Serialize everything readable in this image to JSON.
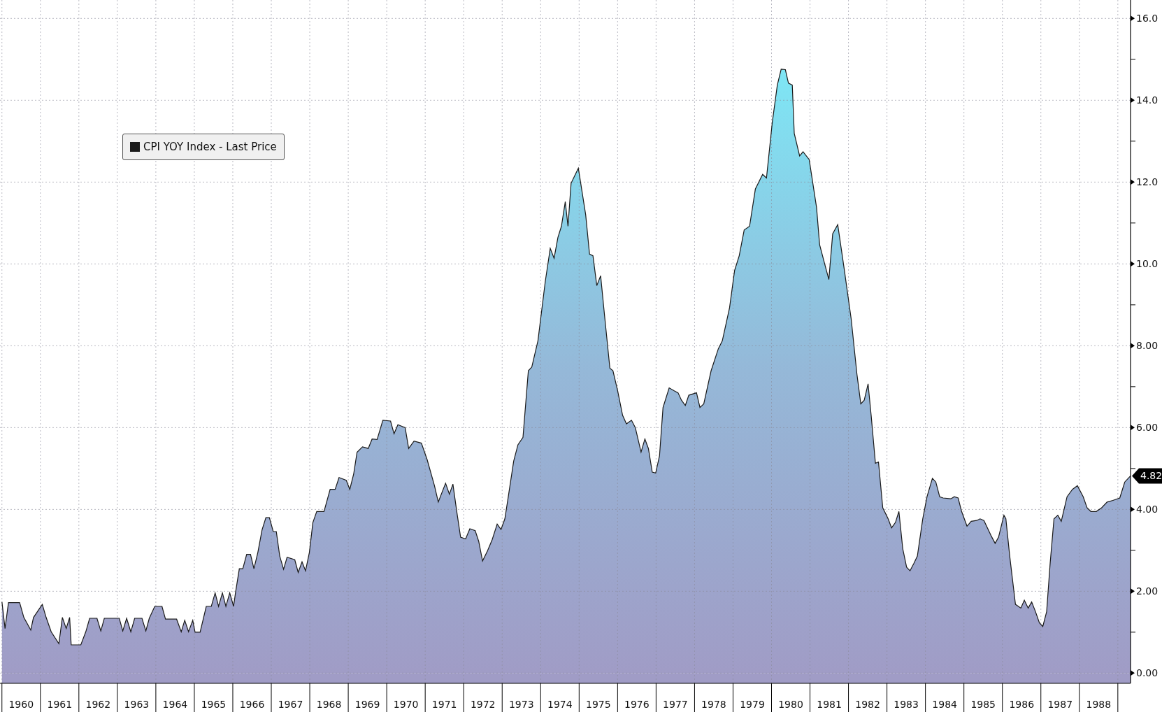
{
  "chart": {
    "last_price": "4.82",
    "chart_data": {
      "type": "area",
      "grid": true,
      "bands": [
        {
          "axis": "y",
          "from": -0.25,
          "to": 0,
          "color": "#a09cc6"
        }
      ],
      "xlim": [
        1959.95,
        1989.33
      ],
      "ylim": [
        -0.25,
        16.45
      ],
      "x": [
        1960.0,
        1960.08,
        1960.17,
        1960.46,
        1960.57,
        1960.75,
        1960.82,
        1961.05,
        1961.15,
        1961.28,
        1961.48,
        1961.57,
        1961.67,
        1961.76,
        1961.8,
        1962.05,
        1962.18,
        1962.28,
        1962.47,
        1962.57,
        1962.66,
        1963.05,
        1963.14,
        1963.24,
        1963.35,
        1963.45,
        1963.64,
        1963.74,
        1963.83,
        1963.97,
        1964.16,
        1964.25,
        1964.54,
        1964.66,
        1964.75,
        1964.85,
        1964.96,
        1965.02,
        1965.15,
        1965.31,
        1965.44,
        1965.54,
        1965.63,
        1965.73,
        1965.82,
        1965.92,
        1966.02,
        1966.07,
        1966.17,
        1966.26,
        1966.36,
        1966.46,
        1966.55,
        1966.65,
        1966.76,
        1966.86,
        1966.95,
        1967.05,
        1967.13,
        1967.22,
        1967.32,
        1967.41,
        1967.61,
        1967.7,
        1967.8,
        1967.89,
        1967.99,
        1968.08,
        1968.18,
        1968.37,
        1968.53,
        1968.66,
        1968.76,
        1968.95,
        1969.04,
        1969.14,
        1969.23,
        1969.37,
        1969.52,
        1969.62,
        1969.75,
        1969.9,
        1970.1,
        1970.19,
        1970.29,
        1970.48,
        1970.57,
        1970.71,
        1970.9,
        1971.05,
        1971.24,
        1971.34,
        1971.53,
        1971.63,
        1971.72,
        1971.82,
        1971.92,
        1972.05,
        1972.16,
        1972.3,
        1972.39,
        1972.49,
        1972.62,
        1972.74,
        1972.87,
        1972.97,
        1973.07,
        1973.16,
        1973.3,
        1973.41,
        1973.54,
        1973.68,
        1973.77,
        1973.93,
        1974.12,
        1974.25,
        1974.35,
        1974.45,
        1974.54,
        1974.64,
        1974.71,
        1974.79,
        1974.98,
        1975.17,
        1975.27,
        1975.36,
        1975.46,
        1975.56,
        1975.65,
        1975.8,
        1975.88,
        1976.0,
        1976.13,
        1976.23,
        1976.36,
        1976.46,
        1976.61,
        1976.71,
        1976.8,
        1976.9,
        1976.99,
        1977.09,
        1977.18,
        1977.34,
        1977.47,
        1977.57,
        1977.66,
        1977.76,
        1977.85,
        1978.05,
        1978.14,
        1978.24,
        1978.43,
        1978.62,
        1978.72,
        1978.91,
        1979.04,
        1979.16,
        1979.29,
        1979.43,
        1979.58,
        1979.77,
        1979.87,
        1980.02,
        1980.15,
        1980.25,
        1980.36,
        1980.44,
        1980.54,
        1980.59,
        1980.73,
        1980.82,
        1980.98,
        1981.17,
        1981.25,
        1981.4,
        1981.49,
        1981.59,
        1981.72,
        1981.88,
        1982.07,
        1982.22,
        1982.32,
        1982.41,
        1982.51,
        1982.59,
        1982.7,
        1982.78,
        1982.89,
        1983.03,
        1983.12,
        1983.22,
        1983.31,
        1983.41,
        1983.51,
        1983.6,
        1983.7,
        1983.79,
        1983.93,
        1984.04,
        1984.18,
        1984.27,
        1984.37,
        1984.46,
        1984.66,
        1984.75,
        1984.85,
        1984.94,
        1985.08,
        1985.19,
        1985.33,
        1985.42,
        1985.52,
        1985.71,
        1985.81,
        1985.9,
        1986.04,
        1986.09,
        1986.19,
        1986.34,
        1986.48,
        1986.57,
        1986.67,
        1986.76,
        1986.86,
        1986.96,
        1987.05,
        1987.15,
        1987.24,
        1987.34,
        1987.44,
        1987.53,
        1987.68,
        1987.82,
        1987.95,
        1988.1,
        1988.2,
        1988.3,
        1988.44,
        1988.58,
        1988.72,
        1988.87,
        1989.05,
        1989.18,
        1989.33
      ],
      "series": [
        {
          "name": "CPI YOY Index - Last Price",
          "color": "#1a1a1a",
          "values": [
            1.74,
            1.09,
            1.72,
            1.72,
            1.36,
            1.05,
            1.36,
            1.68,
            1.36,
            1.01,
            0.72,
            1.36,
            1.09,
            1.36,
            0.69,
            0.69,
            1.01,
            1.34,
            1.34,
            1.03,
            1.34,
            1.34,
            1.03,
            1.34,
            1.01,
            1.34,
            1.34,
            1.03,
            1.34,
            1.63,
            1.63,
            1.32,
            1.32,
            1.01,
            1.29,
            1.01,
            1.29,
            1.0,
            1.0,
            1.63,
            1.63,
            1.96,
            1.63,
            1.96,
            1.63,
            1.96,
            1.63,
            1.96,
            2.55,
            2.55,
            2.9,
            2.9,
            2.55,
            2.95,
            3.5,
            3.8,
            3.8,
            3.46,
            3.46,
            2.86,
            2.54,
            2.83,
            2.77,
            2.46,
            2.72,
            2.5,
            2.95,
            3.68,
            3.95,
            3.95,
            4.49,
            4.49,
            4.78,
            4.71,
            4.49,
            4.86,
            5.4,
            5.53,
            5.49,
            5.72,
            5.71,
            6.18,
            6.16,
            5.85,
            6.07,
            6.0,
            5.49,
            5.67,
            5.62,
            5.22,
            4.58,
            4.18,
            4.64,
            4.37,
            4.62,
            3.95,
            3.32,
            3.28,
            3.53,
            3.48,
            3.22,
            2.74,
            2.99,
            3.26,
            3.64,
            3.51,
            3.77,
            4.31,
            5.18,
            5.58,
            5.76,
            7.39,
            7.48,
            8.12,
            9.57,
            10.38,
            10.14,
            10.65,
            10.92,
            11.52,
            10.92,
            11.97,
            12.34,
            11.2,
            10.24,
            10.2,
            9.47,
            9.71,
            8.84,
            7.45,
            7.39,
            6.9,
            6.3,
            6.09,
            6.18,
            6.0,
            5.4,
            5.72,
            5.49,
            4.91,
            4.89,
            5.31,
            6.49,
            6.97,
            6.9,
            6.85,
            6.67,
            6.54,
            6.79,
            6.85,
            6.49,
            6.58,
            7.39,
            7.93,
            8.12,
            8.93,
            9.84,
            10.2,
            10.83,
            10.92,
            11.83,
            12.19,
            12.1,
            13.46,
            14.37,
            14.76,
            14.75,
            14.42,
            14.37,
            13.19,
            12.64,
            12.74,
            12.55,
            11.38,
            10.47,
            9.93,
            9.62,
            10.74,
            10.96,
            9.93,
            8.66,
            7.3,
            6.58,
            6.67,
            7.07,
            6.3,
            5.13,
            5.16,
            4.04,
            3.77,
            3.55,
            3.68,
            3.95,
            3.04,
            2.59,
            2.5,
            2.68,
            2.86,
            3.77,
            4.31,
            4.76,
            4.67,
            4.31,
            4.28,
            4.26,
            4.31,
            4.28,
            3.95,
            3.59,
            3.71,
            3.73,
            3.77,
            3.73,
            3.35,
            3.17,
            3.32,
            3.86,
            3.77,
            2.86,
            1.68,
            1.59,
            1.78,
            1.59,
            1.74,
            1.5,
            1.23,
            1.14,
            1.5,
            2.68,
            3.77,
            3.86,
            3.71,
            4.31,
            4.49,
            4.58,
            4.31,
            4.04,
            3.95,
            3.95,
            4.04,
            4.18,
            4.22,
            4.28,
            4.67,
            4.82
          ]
        }
      ],
      "xticks": [
        {
          "value": 1960.5,
          "label": "1960"
        },
        {
          "value": 1961.5,
          "label": "1961"
        },
        {
          "value": 1962.5,
          "label": "1962"
        },
        {
          "value": 1963.5,
          "label": "1963"
        },
        {
          "value": 1964.5,
          "label": "1964"
        },
        {
          "value": 1965.5,
          "label": "1965"
        },
        {
          "value": 1966.5,
          "label": "1966"
        },
        {
          "value": 1967.5,
          "label": "1967"
        },
        {
          "value": 1968.5,
          "label": "1968"
        },
        {
          "value": 1969.5,
          "label": "1969"
        },
        {
          "value": 1970.5,
          "label": "1970"
        },
        {
          "value": 1971.5,
          "label": "1971"
        },
        {
          "value": 1972.5,
          "label": "1972"
        },
        {
          "value": 1973.5,
          "label": "1973"
        },
        {
          "value": 1974.5,
          "label": "1974"
        },
        {
          "value": 1975.5,
          "label": "1975"
        },
        {
          "value": 1976.5,
          "label": "1976"
        },
        {
          "value": 1977.5,
          "label": "1977"
        },
        {
          "value": 1978.5,
          "label": "1978"
        },
        {
          "value": 1979.5,
          "label": "1979"
        },
        {
          "value": 1980.5,
          "label": "1980"
        },
        {
          "value": 1981.5,
          "label": "1981"
        },
        {
          "value": 1982.5,
          "label": "1982"
        },
        {
          "value": 1983.5,
          "label": "1983"
        },
        {
          "value": 1984.5,
          "label": "1984"
        },
        {
          "value": 1985.5,
          "label": "1985"
        },
        {
          "value": 1986.5,
          "label": "1986"
        },
        {
          "value": 1987.5,
          "label": "1987"
        },
        {
          "value": 1988.5,
          "label": "1988"
        }
      ],
      "yticks": [
        {
          "value": 0,
          "label": "0.00"
        },
        {
          "value": 2,
          "label": "2.00"
        },
        {
          "value": 4,
          "label": "4.00"
        },
        {
          "value": 6,
          "label": "6.00"
        },
        {
          "value": 8,
          "label": "8.00"
        },
        {
          "value": 10,
          "label": "10.0"
        },
        {
          "value": 12,
          "label": "12.0"
        },
        {
          "value": 14,
          "label": "14.0"
        },
        {
          "value": 16,
          "label": "16.0"
        }
      ]
    }
  }
}
